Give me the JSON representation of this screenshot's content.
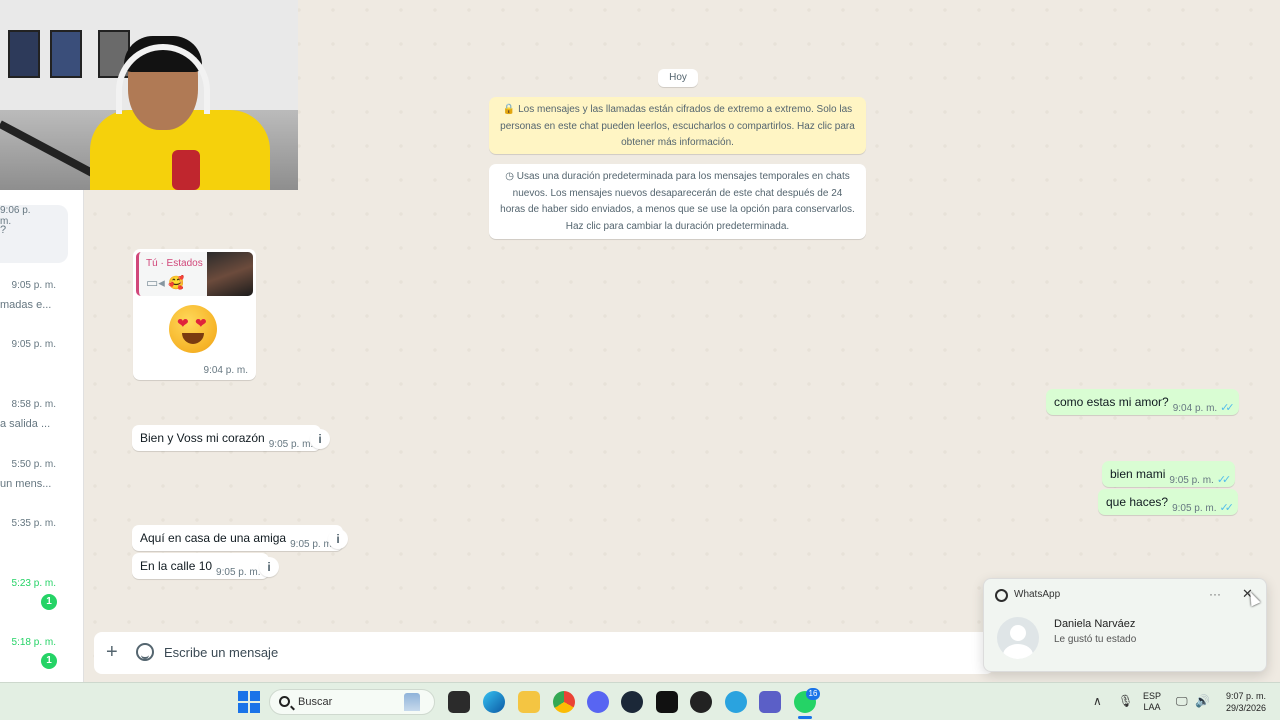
{
  "chat_list": {
    "items": [
      {
        "time": "9:06 p. m.",
        "preview": "?",
        "unread": false,
        "badge": ""
      },
      {
        "time": "9:05 p. m.",
        "preview": "madas e...",
        "unread": false,
        "badge": ""
      },
      {
        "time": "9:05 p. m.",
        "preview": "",
        "unread": false,
        "badge": ""
      },
      {
        "time": "8:58 p. m.",
        "preview": "a salida ...",
        "unread": false,
        "badge": ""
      },
      {
        "time": "5:50 p. m.",
        "preview": "un mens...",
        "unread": false,
        "badge": ""
      },
      {
        "time": "5:35 p. m.",
        "preview": "",
        "unread": false,
        "badge": ""
      },
      {
        "time": "5:23 p. m.",
        "preview": "",
        "unread": true,
        "badge": "1"
      },
      {
        "time": "5:18 p. m.",
        "preview": "",
        "unread": true,
        "badge": "1"
      }
    ]
  },
  "conversation": {
    "date_chip": "Hoy",
    "encryption_notice": "🔒 Los mensajes y las llamadas están cifrados de extremo a extremo. Solo las personas en este chat pueden leerlos, escucharlos o compartirlos. Haz clic para obtener más información.",
    "temporary_notice": "◷ Usas una duración predeterminada para los mensajes temporales en chats nuevos. Los mensajes nuevos desaparecerán de este chat después de 24 horas de haber sido enviados, a menos que se use la opción para conservarlos. Haz clic para cambiar la duración predeterminada.",
    "status_reply": {
      "quote_title": "Tú · Estados",
      "quote_icons": "▭◂ 🥰",
      "time": "9:04 p. m."
    },
    "messages": [
      {
        "dir": "out",
        "text": "como estas mi amor?",
        "time": "9:04 p. m.",
        "ticks": "✓✓"
      },
      {
        "dir": "in",
        "text": "Bien y Voss mi corazón",
        "time": "9:05 p. m."
      },
      {
        "dir": "out",
        "text": "bien mami",
        "time": "9:05 p. m.",
        "ticks": "✓✓"
      },
      {
        "dir": "out",
        "text": "que haces?",
        "time": "9:05 p. m.",
        "ticks": "✓✓"
      },
      {
        "dir": "in",
        "text": "Aquí en casa de una amiga",
        "time": "9:05 p. m."
      },
      {
        "dir": "in",
        "text": "En la calle 10",
        "time": "9:05 p. m."
      }
    ],
    "info_glyph": "i"
  },
  "composer": {
    "placeholder": "Escribe un mensaje",
    "value": "",
    "plus_glyph": "+"
  },
  "toast": {
    "app_name": "WhatsApp",
    "more_glyph": "···",
    "close_glyph": "✕",
    "sender": "Daniela Narváez",
    "body": "Le gustó tu estado"
  },
  "taskbar": {
    "search_placeholder": "Buscar",
    "whatsapp_badge": "16",
    "lang_line1": "ESP",
    "lang_line2": "LAA",
    "time": "9:07 p. m.",
    "date": "29/3/2026",
    "tray_up_glyph": "∧",
    "icons": [
      "file-explorer-icon",
      "edge-icon",
      "folder-icon",
      "chrome-icon",
      "discord-icon",
      "steam-icon",
      "tiktok-icon",
      "recorder-icon",
      "telegram-icon",
      "teams-icon",
      "whatsapp-icon"
    ]
  },
  "colors": {
    "chat_bg": "#efeae2",
    "outgoing_bubble": "#d9fdd3",
    "read_ticks": "#53bdeb",
    "unread_green": "#25d366",
    "status_accent": "#d1477a"
  }
}
